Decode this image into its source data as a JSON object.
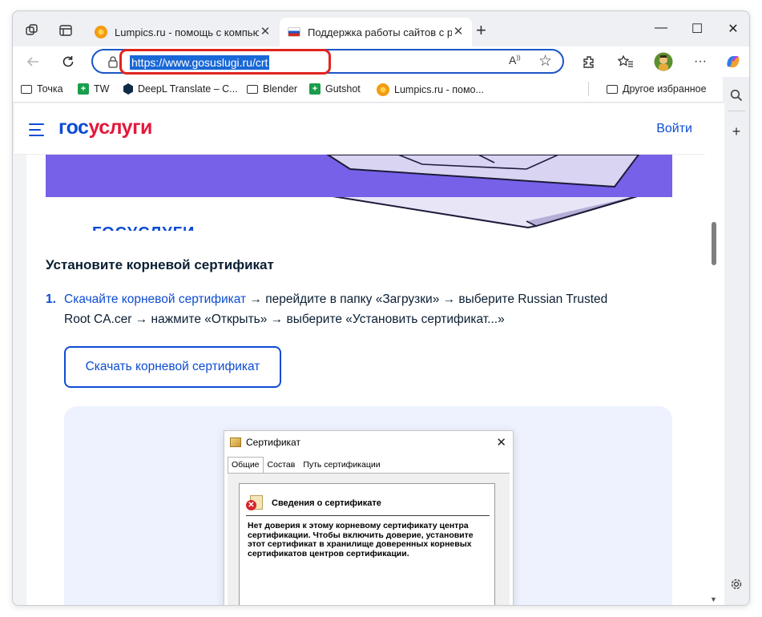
{
  "tabs": [
    {
      "title": "Lumpics.ru - помощь с компьюте",
      "close": "✕"
    },
    {
      "title": "Поддержка работы сайтов с рос",
      "close": "✕"
    }
  ],
  "new_tab": "+",
  "window_controls": {
    "minimize": "—",
    "maximize": "☐",
    "close": "✕"
  },
  "address": {
    "url": "https://www.gosuslugi.ru/crt"
  },
  "bookmarks": [
    {
      "label": "Точка",
      "icon": "folder-icon"
    },
    {
      "label": "TW",
      "icon": "tw-icon"
    },
    {
      "label": "DeepL Translate – C...",
      "icon": "deepl-icon"
    },
    {
      "label": "Blender",
      "icon": "folder-icon"
    },
    {
      "label": "Gutshot",
      "icon": "gutshot-icon"
    },
    {
      "label": "Lumpics.ru - помо...",
      "icon": "orange-icon"
    },
    {
      "label": "Другое избранное",
      "icon": "folder-icon"
    }
  ],
  "site": {
    "logo_part1": "гос",
    "logo_part2": "услуги",
    "login": "Войти",
    "partial_text": "ГОСУСЛУГИ",
    "section_title": "Установите корневой сертификат",
    "step_num": "1.",
    "step_link": "Скачайте корневой сертификат",
    "step_rest": " → перейдите в папку «Загрузки» → выберите Russian Trusted Root CA.cer → нажмите «Открыть» → выберите «Установить сертификат...»",
    "download_button": "Скачать корневой сертификат"
  },
  "cert_dialog": {
    "title": "Сертификат",
    "tabs": [
      "Общие",
      "Состав",
      "Путь сертификации"
    ],
    "heading": "Сведения о сертификате",
    "body": "Нет доверия к этому корневому сертификату центра сертификации. Чтобы включить доверие, установите этот сертификат в хранилище доверенных корневых сертификатов центров сертификации."
  },
  "colors": {
    "brand_blue": "#0d4cd3",
    "brand_red": "#e4173a",
    "banner_purple": "#7661e8",
    "url_highlight_red": "#e0241d"
  }
}
